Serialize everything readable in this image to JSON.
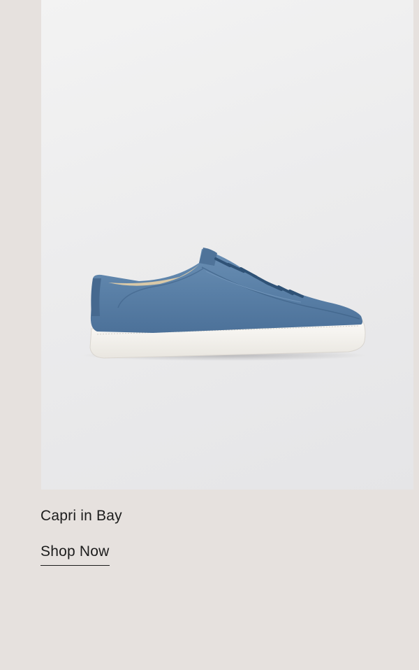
{
  "product": {
    "name": "Capri in Bay",
    "cta_label": "Shop Now",
    "image_alt": "Capri in Bay sneaker",
    "shoe_color": "#5b82a8",
    "sole_color": "#f4f2ee",
    "background_color": "#e6e1de"
  }
}
